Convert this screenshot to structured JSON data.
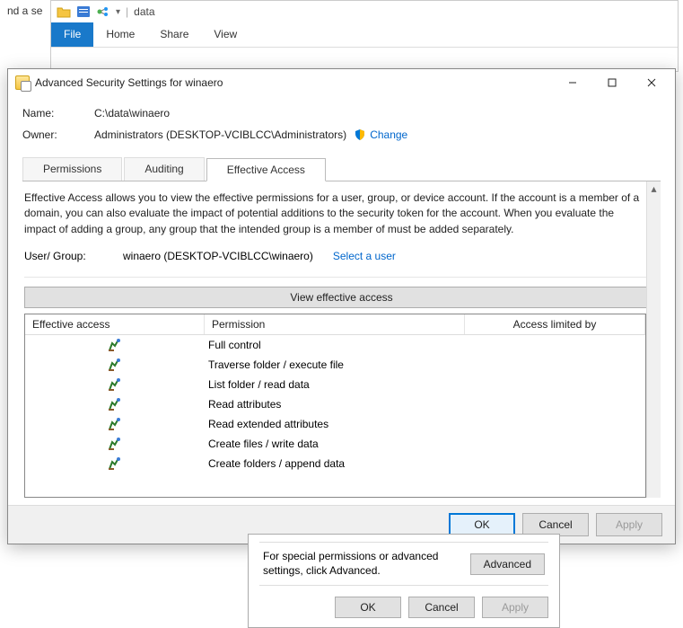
{
  "find_bar": {
    "text": "nd a se"
  },
  "explorer": {
    "title_path": "data",
    "tabs": {
      "file": "File",
      "home": "Home",
      "share": "Share",
      "view": "View"
    }
  },
  "dialog": {
    "title": "Advanced Security Settings for winaero",
    "name_label": "Name:",
    "name_value": "C:\\data\\winaero",
    "owner_label": "Owner:",
    "owner_value": "Administrators (DESKTOP-VCIBLCC\\Administrators)",
    "change_link": "Change",
    "tabs": {
      "permissions": "Permissions",
      "auditing": "Auditing",
      "effective": "Effective Access"
    },
    "effective": {
      "description": "Effective Access allows you to view the effective permissions for a user, group, or device account. If the account is a member of a domain, you can also evaluate the impact of potential additions to the security token for the account. When you evaluate the impact of adding a group, any group that the intended group is a member of must be added separately.",
      "usergroup_label": "User/ Group:",
      "usergroup_value": "winaero (DESKTOP-VCIBLCC\\winaero)",
      "select_user": "Select a user",
      "view_button": "View effective access",
      "columns": {
        "ea": "Effective access",
        "perm": "Permission",
        "lim": "Access limited by"
      },
      "rows": [
        {
          "perm": "Full control"
        },
        {
          "perm": "Traverse folder / execute file"
        },
        {
          "perm": "List folder / read data"
        },
        {
          "perm": "Read attributes"
        },
        {
          "perm": "Read extended attributes"
        },
        {
          "perm": "Create files / write data"
        },
        {
          "perm": "Create folders / append data"
        }
      ]
    },
    "footer": {
      "ok": "OK",
      "cancel": "Cancel",
      "apply": "Apply"
    }
  },
  "prop_panel": {
    "text": "For special permissions or advanced settings, click Advanced.",
    "advanced": "Advanced",
    "ok": "OK",
    "cancel": "Cancel",
    "apply": "Apply"
  }
}
